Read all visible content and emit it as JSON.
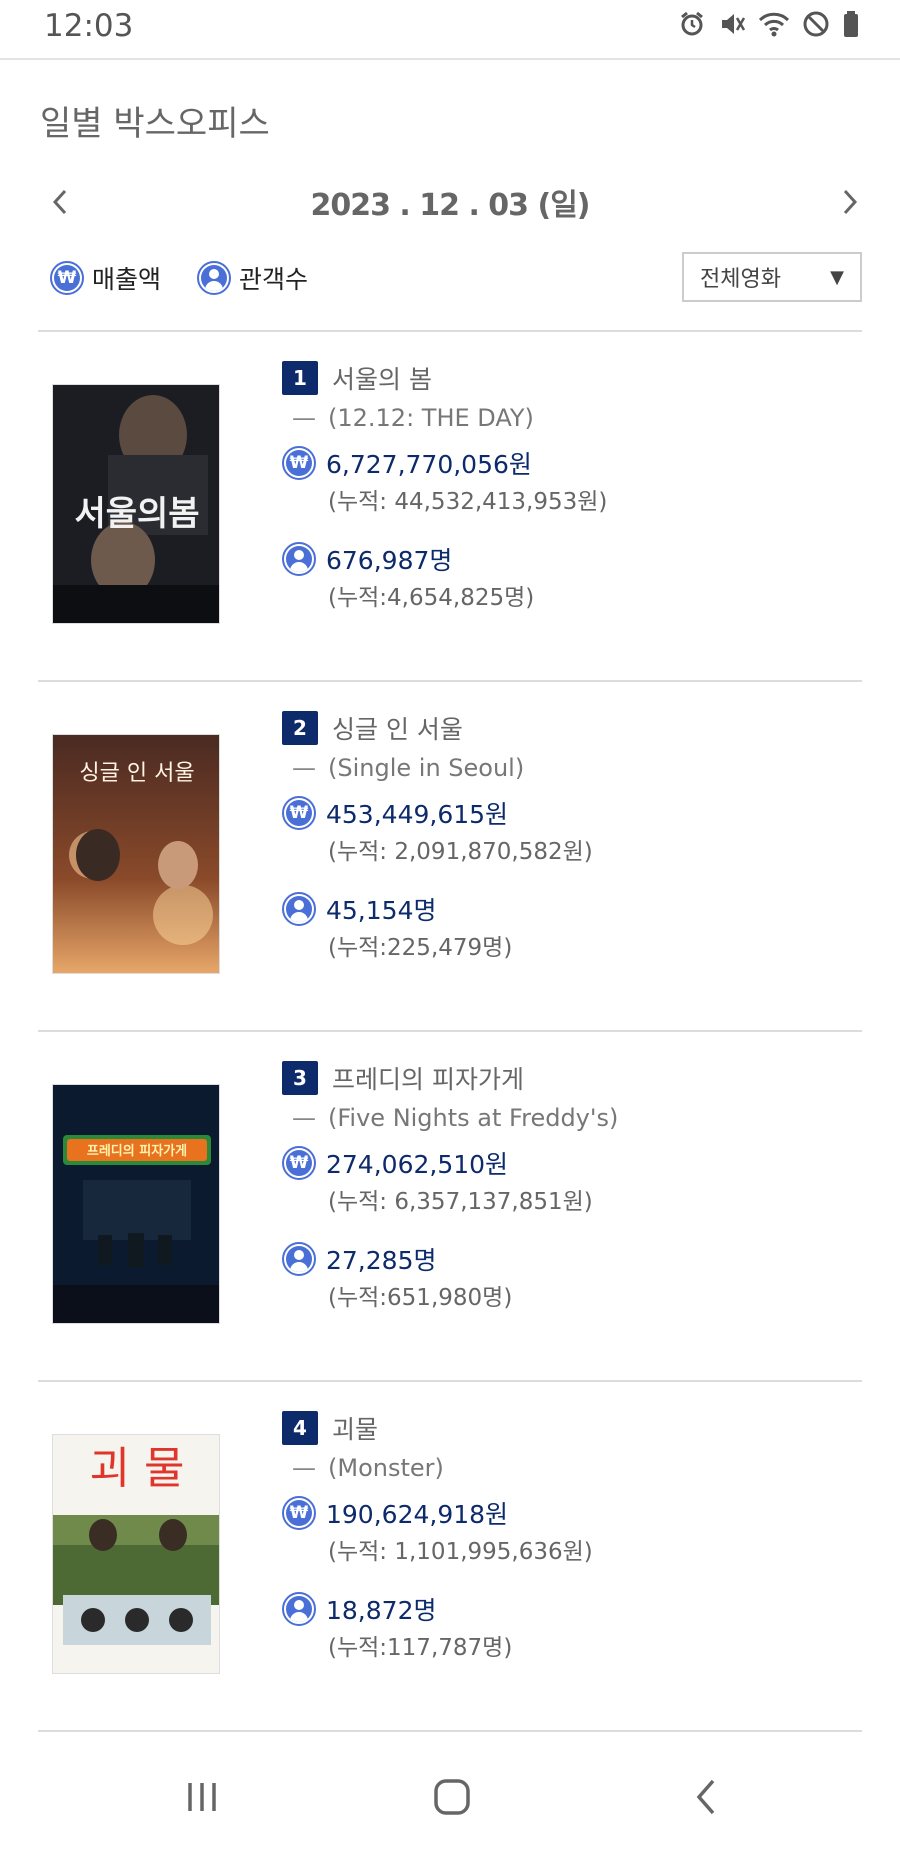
{
  "status_bar": {
    "time": "12:03",
    "icons": [
      "alarm-icon",
      "mute-icon",
      "wifi-icon",
      "do-not-disturb-icon",
      "battery-icon"
    ]
  },
  "page": {
    "title": "일별 박스오피스"
  },
  "date_nav": {
    "date": "2023 . 12 . 03 (일)"
  },
  "legend": {
    "sales_label": "매출액",
    "audience_label": "관객수",
    "sales_symbol": "₩"
  },
  "filter": {
    "selected": "전체영화"
  },
  "colors": {
    "accent": "#4a6fd6",
    "rank_badge": "#0d2a6b",
    "value_text": "#0d2a6b"
  },
  "movies": [
    {
      "rank": "1",
      "title_ko": "서울의 봄",
      "title_en": "(12.12: THE DAY)",
      "dash": "—",
      "sales": "6,727,770,056원",
      "sales_cum": "(누적: 44,532,413,953원)",
      "audience": "676,987명",
      "audience_cum": "(누적:4,654,825명)",
      "poster_text": "서울의봄"
    },
    {
      "rank": "2",
      "title_ko": "싱글 인 서울",
      "title_en": "(Single in Seoul)",
      "dash": "—",
      "sales": "453,449,615원",
      "sales_cum": "(누적: 2,091,870,582원)",
      "audience": "45,154명",
      "audience_cum": "(누적:225,479명)",
      "poster_text": "싱글 인 서울"
    },
    {
      "rank": "3",
      "title_ko": "프레디의 피자가게",
      "title_en": "(Five Nights at Freddy's)",
      "dash": "—",
      "sales": "274,062,510원",
      "sales_cum": "(누적: 6,357,137,851원)",
      "audience": "27,285명",
      "audience_cum": "(누적:651,980명)",
      "poster_text": "프레디의 피자가게"
    },
    {
      "rank": "4",
      "title_ko": "괴물",
      "title_en": "(Monster)",
      "dash": "—",
      "sales": "190,624,918원",
      "sales_cum": "(누적: 1,101,995,636원)",
      "audience": "18,872명",
      "audience_cum": "(누적:117,787명)",
      "poster_text": "괴 물"
    }
  ]
}
